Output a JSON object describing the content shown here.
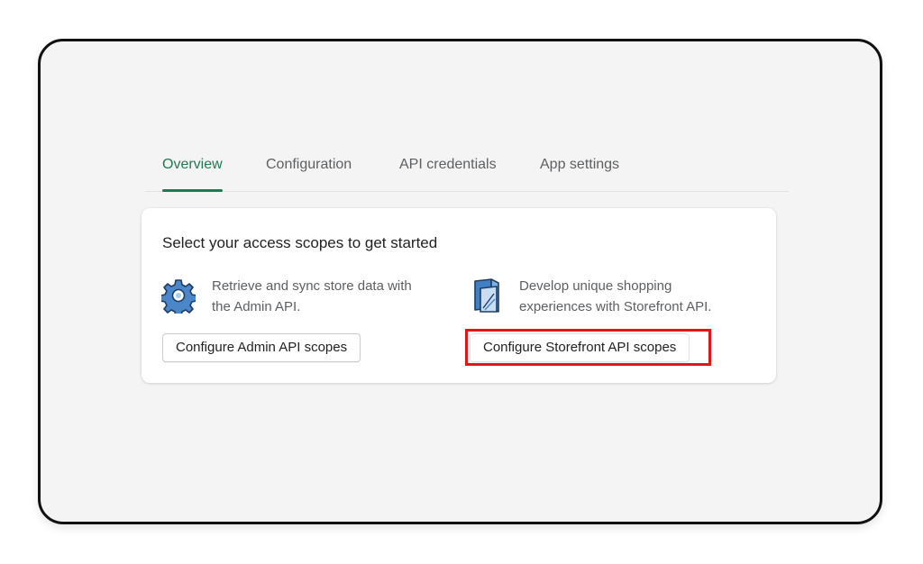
{
  "tabs": [
    {
      "label": "Overview",
      "active": true
    },
    {
      "label": "Configuration",
      "active": false
    },
    {
      "label": "API credentials",
      "active": false
    },
    {
      "label": "App settings",
      "active": false
    }
  ],
  "card": {
    "title": "Select your access scopes to get started",
    "admin": {
      "icon": "gear-icon",
      "line1": "Retrieve and sync store data with",
      "line2": "the Admin API.",
      "button": "Configure Admin API scopes"
    },
    "storefront": {
      "icon": "storefront-icon",
      "line1": "Develop unique shopping",
      "line2": "experiences with Storefront API.",
      "button": "Configure Storefront API scopes",
      "highlighted": true
    }
  },
  "colors": {
    "accent": "#1f7a54",
    "highlight": "#e0161b",
    "background": "#f4f4f4"
  }
}
